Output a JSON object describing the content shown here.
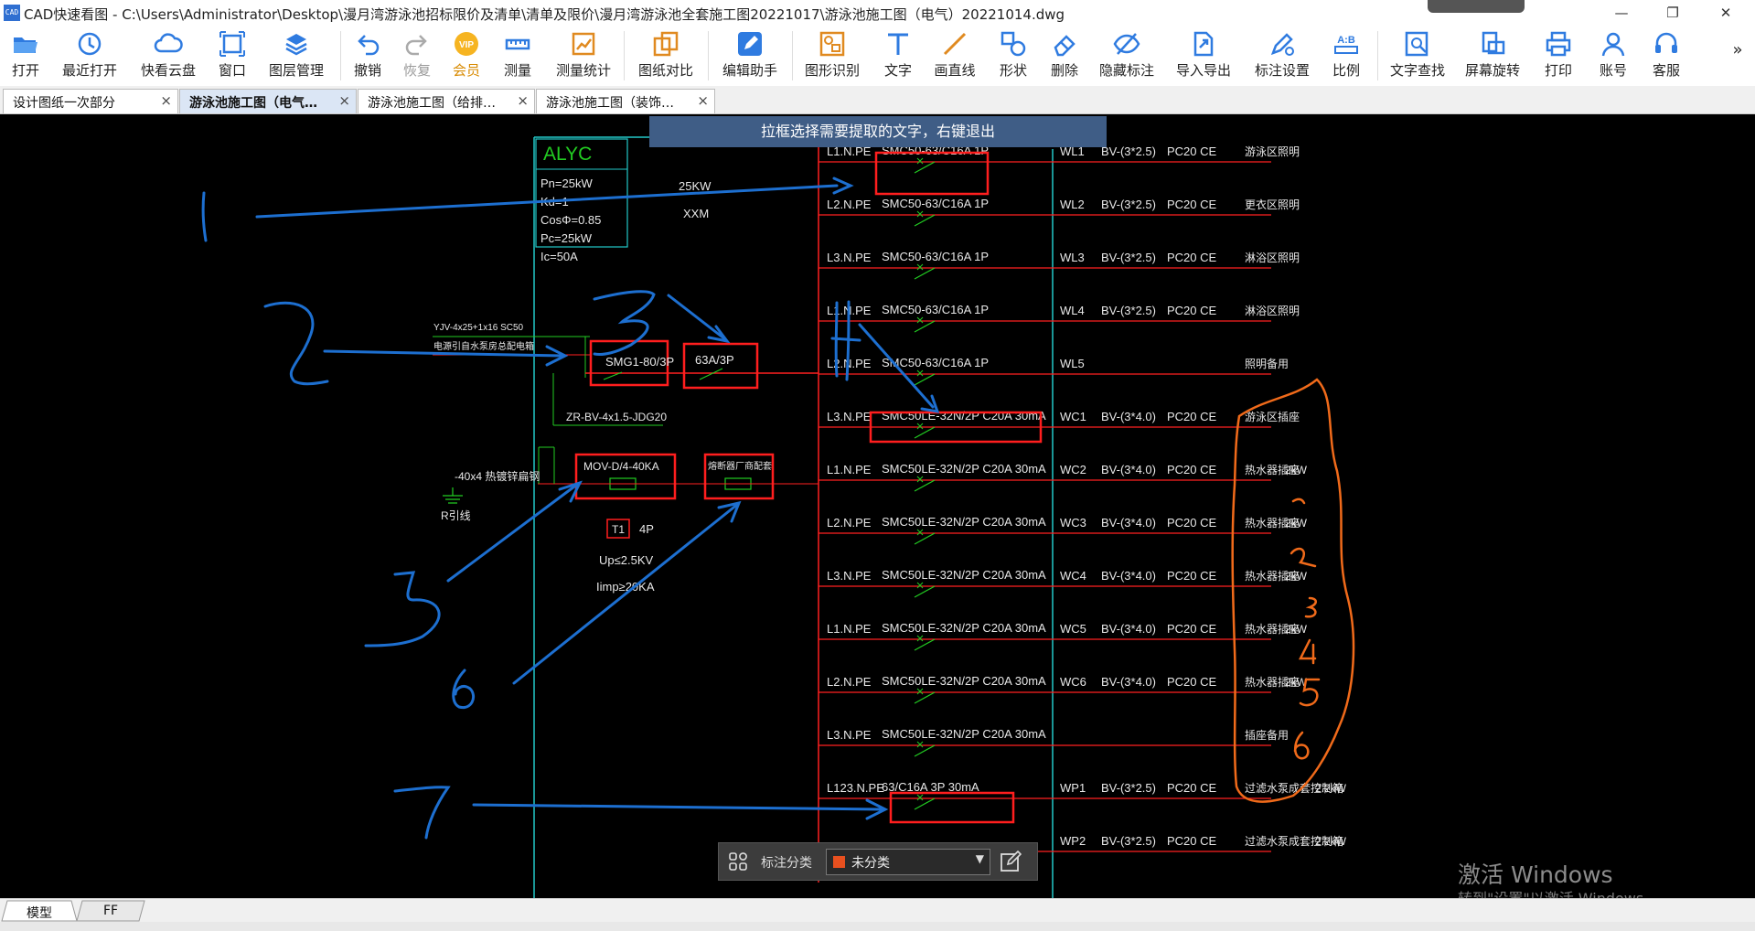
{
  "window": {
    "title": "CAD快速看图 - C:\\Users\\Administrator\\Desktop\\漫月湾游泳池招标限价及清单\\清单及限价\\漫月湾游泳池全套施工图20221017\\游泳池施工图（电气）20221014.dwg",
    "app_icon": "CAD"
  },
  "toolbar": {
    "items": [
      {
        "label": "打开",
        "icon": "folder-open-icon"
      },
      {
        "label": "最近打开",
        "icon": "recent-icon"
      },
      {
        "label": "快看云盘",
        "icon": "cloud-icon"
      },
      {
        "label": "窗口",
        "icon": "window-icon"
      },
      {
        "label": "图层管理",
        "icon": "layers-icon"
      },
      {
        "label": "撤销",
        "icon": "undo-icon"
      },
      {
        "label": "恢复",
        "icon": "redo-icon"
      },
      {
        "label": "会员",
        "icon": "vip-icon",
        "badge": "VIP"
      },
      {
        "label": "测量",
        "icon": "ruler-icon"
      },
      {
        "label": "测量统计",
        "icon": "measure-stats-icon"
      },
      {
        "label": "图纸对比",
        "icon": "compare-icon"
      },
      {
        "label": "编辑助手",
        "icon": "edit-assistant-icon"
      },
      {
        "label": "图形识别",
        "icon": "shape-recognition-icon"
      },
      {
        "label": "文字",
        "icon": "text-icon"
      },
      {
        "label": "画直线",
        "icon": "line-icon"
      },
      {
        "label": "形状",
        "icon": "shape-icon"
      },
      {
        "label": "删除",
        "icon": "eraser-icon"
      },
      {
        "label": "隐藏标注",
        "icon": "hide-annotation-icon"
      },
      {
        "label": "导入导出",
        "icon": "import-export-icon"
      },
      {
        "label": "标注设置",
        "icon": "annotation-settings-icon"
      },
      {
        "label": "比例",
        "icon": "scale-icon",
        "badge": "A:B"
      },
      {
        "label": "文字查找",
        "icon": "text-search-icon"
      },
      {
        "label": "屏幕旋转",
        "icon": "rotate-screen-icon"
      },
      {
        "label": "打印",
        "icon": "printer-icon"
      },
      {
        "label": "账号",
        "icon": "account-icon"
      },
      {
        "label": "客服",
        "icon": "headset-icon"
      }
    ],
    "overflow": "»"
  },
  "tabs": [
    {
      "label": "设计图纸一次部分",
      "close": "×",
      "active": false
    },
    {
      "label": "游泳池施工图（电气…",
      "close": "×",
      "active": true
    },
    {
      "label": "游泳池施工图（给排…",
      "close": "×",
      "active": false
    },
    {
      "label": "游泳池施工图（装饰…",
      "close": "×",
      "active": false
    }
  ],
  "hint": "拉框选择需要提取的文字，右键退出",
  "drawing": {
    "panel_name": "ALYC",
    "panel_params": [
      "Pn=25kW",
      "Kd=1",
      "CosΦ=0.85",
      "Pc=25kW",
      "Ic=50A"
    ],
    "load_power": "25KW",
    "panel_code": "XXM",
    "incoming_cable": "YJV-4x25+1x16  SC50",
    "incoming_note": "电源引自水泵房总配电箱",
    "main_switch": "SMG1-80/3P",
    "main_breaker": "63A/3P",
    "branch_cable": "ZR-BV-4x1.5-JDG20",
    "spd": "MOV-D/4-40KA",
    "spd_breaker": "熔断器厂商配套",
    "ground_bar": "-40x4 热镀锌扁钢",
    "ground_note": "R引线",
    "spd_class": "T1",
    "spd_poles": "4P",
    "spd_up": "Up≤2.5KV",
    "spd_imp": "Iimp≥20KA",
    "circuits": [
      {
        "phase": "L1.N.PE",
        "device": "SMC50-63/C16A 1P",
        "code": "WL1",
        "cable": "BV-(3*2.5)",
        "pipe": "PC20 CE",
        "use": "游泳区照明",
        "power": ""
      },
      {
        "phase": "L2.N.PE",
        "device": "SMC50-63/C16A 1P",
        "code": "WL2",
        "cable": "BV-(3*2.5)",
        "pipe": "PC20 CE",
        "use": "更衣区照明",
        "power": ""
      },
      {
        "phase": "L3.N.PE",
        "device": "SMC50-63/C16A 1P",
        "code": "WL3",
        "cable": "BV-(3*2.5)",
        "pipe": "PC20 CE",
        "use": "淋浴区照明",
        "power": ""
      },
      {
        "phase": "L1.N.PE",
        "device": "SMC50-63/C16A 1P",
        "code": "WL4",
        "cable": "BV-(3*2.5)",
        "pipe": "PC20 CE",
        "use": "淋浴区照明",
        "power": ""
      },
      {
        "phase": "L2.N.PE",
        "device": "SMC50-63/C16A 1P",
        "code": "WL5",
        "cable": "",
        "pipe": "",
        "use": "照明备用",
        "power": ""
      },
      {
        "phase": "L3.N.PE",
        "device": "SMC50LE-32N/2P C20A 30mA",
        "code": "WC1",
        "cable": "BV-(3*4.0)",
        "pipe": "PC20 CE",
        "use": "游泳区插座",
        "power": ""
      },
      {
        "phase": "L1.N.PE",
        "device": "SMC50LE-32N/2P C20A 30mA",
        "code": "WC2",
        "cable": "BV-(3*4.0)",
        "pipe": "PC20 CE",
        "use": "热水器插座",
        "power": "2kW"
      },
      {
        "phase": "L2.N.PE",
        "device": "SMC50LE-32N/2P C20A 30mA",
        "code": "WC3",
        "cable": "BV-(3*4.0)",
        "pipe": "PC20 CE",
        "use": "热水器插座",
        "power": "2kW"
      },
      {
        "phase": "L3.N.PE",
        "device": "SMC50LE-32N/2P C20A 30mA",
        "code": "WC4",
        "cable": "BV-(3*4.0)",
        "pipe": "PC20 CE",
        "use": "热水器插座",
        "power": "2kW"
      },
      {
        "phase": "L1.N.PE",
        "device": "SMC50LE-32N/2P C20A 30mA",
        "code": "WC5",
        "cable": "BV-(3*4.0)",
        "pipe": "PC20 CE",
        "use": "热水器插座",
        "power": "2kW"
      },
      {
        "phase": "L2.N.PE",
        "device": "SMC50LE-32N/2P C20A 30mA",
        "code": "WC6",
        "cable": "BV-(3*4.0)",
        "pipe": "PC20 CE",
        "use": "热水器插座",
        "power": "2kW"
      },
      {
        "phase": "L3.N.PE",
        "device": "SMC50LE-32N/2P C20A 30mA",
        "code": "",
        "cable": "",
        "pipe": "",
        "use": "插座备用",
        "power": ""
      },
      {
        "phase": "L123.N.PE",
        "device": "63/C16A 3P 30mA",
        "code": "WP1",
        "cable": "BV-(3*2.5)",
        "pipe": "PC20 CE",
        "use": "过滤水泵成套控制箱",
        "power": "2.2kW"
      },
      {
        "phase": "",
        "device": "",
        "code": "WP2",
        "cable": "BV-(3*2.5)",
        "pipe": "PC20 CE",
        "use": "过滤水泵成套控制箱",
        "power": "2.2kW"
      }
    ],
    "markup_numbers": [
      "1",
      "2",
      "3",
      "4",
      "5",
      "6",
      "7"
    ],
    "orange_numbers": [
      "1",
      "2",
      "3",
      "4",
      "5",
      "6"
    ]
  },
  "annotation_bar": {
    "label": "标注分类",
    "selected": "未分类",
    "swatch_color": "#e8501f",
    "caret": "▼"
  },
  "watermark": {
    "line1": "激活 Windows",
    "line2": "转到\"设置\"以激活 Windows。"
  },
  "bottom_tabs": [
    "模型",
    "FF"
  ],
  "colors": {
    "cad_background": "#000000",
    "cad_line_red": "#ff2020",
    "cad_line_green": "#22cc22",
    "cad_line_cyan": "#22c8c8",
    "markup_blue": "#1d6fd0",
    "markup_orange": "#f06a1a",
    "highlight_box": "#ff1e1e"
  }
}
